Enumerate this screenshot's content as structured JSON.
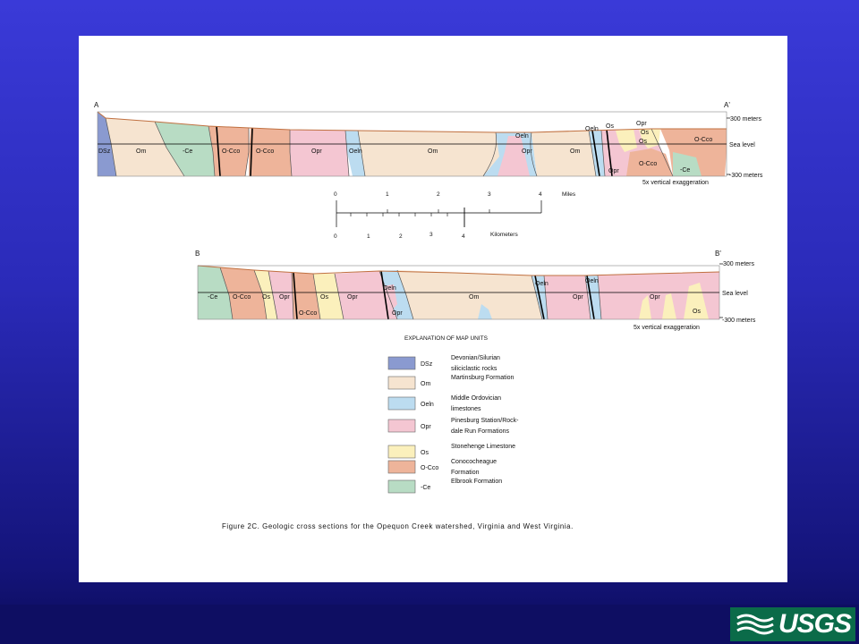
{
  "footer": {
    "logo_text": "USGS",
    "brand_color": "#0b6b49"
  },
  "sectionA": {
    "start_label": "A",
    "end_label": "A'",
    "elevation_top": "300 meters",
    "elevation_mid": "Sea level",
    "elevation_bottom": "-300 meters",
    "exaggeration": "5x vertical exaggeration",
    "units": [
      "DSz",
      "Om",
      "-Ce",
      "O-Cco",
      "O-Cco",
      "Opr",
      "Oeln",
      "Om",
      "Oeln",
      "Opr",
      "Om",
      "Oeln",
      "Os",
      "Opr",
      "Os",
      "Os",
      "O-Cco",
      "Opr",
      "O-Cco",
      "-Ce"
    ]
  },
  "scale": {
    "miles_label": "Miles",
    "miles_ticks": [
      "0",
      "1",
      "2",
      "3",
      "4"
    ],
    "km_label": "Kilometers",
    "km_ticks": [
      "0",
      "1",
      "2",
      "3",
      "4"
    ]
  },
  "sectionB": {
    "start_label": "B",
    "end_label": "B'",
    "elevation_top": "300 meters",
    "elevation_mid": "Sea level",
    "elevation_bottom": "-300 meters",
    "exaggeration": "5x vertical exaggeration",
    "units": [
      "-Ce",
      "O-Cco",
      "Os",
      "Opr",
      "O-Cco",
      "Os",
      "Opr",
      "Oeln",
      "Opr",
      "Om",
      "Oeln",
      "Oeln",
      "Opr",
      "Opr",
      "Os"
    ]
  },
  "legend": {
    "title": "EXPLANATION OF MAP UNITS",
    "items": [
      {
        "code": "DSz",
        "label_lines": [
          "Devonian/Silurian",
          "siliciclastic rocks"
        ],
        "color": "#8a9ad0"
      },
      {
        "code": "Om",
        "label_lines": [
          "Martinsburg Formation"
        ],
        "color": "#f6e4d0"
      },
      {
        "code": "Oeln",
        "label_lines": [
          "Middle Ordovician",
          "limestones"
        ],
        "color": "#bcdcf0"
      },
      {
        "code": "Opr",
        "label_lines": [
          "Pinesburg Station/Rock-",
          "dale Run Formations"
        ],
        "color": "#f4c6d2"
      },
      {
        "code": "Os",
        "label_lines": [
          "Stonehenge Limestone"
        ],
        "color": "#fbf0bc"
      },
      {
        "code": "O-Cco",
        "label_lines": [
          "Conococheague",
          "Formation"
        ],
        "color": "#eeb49a"
      },
      {
        "code": "-Ce",
        "label_lines": [
          "Elbrook Formation"
        ],
        "color": "#b8dcc4"
      }
    ]
  },
  "caption": "Figure 2C. Geologic cross sections for the Opequon Creek watershed, Virginia and West Virginia."
}
